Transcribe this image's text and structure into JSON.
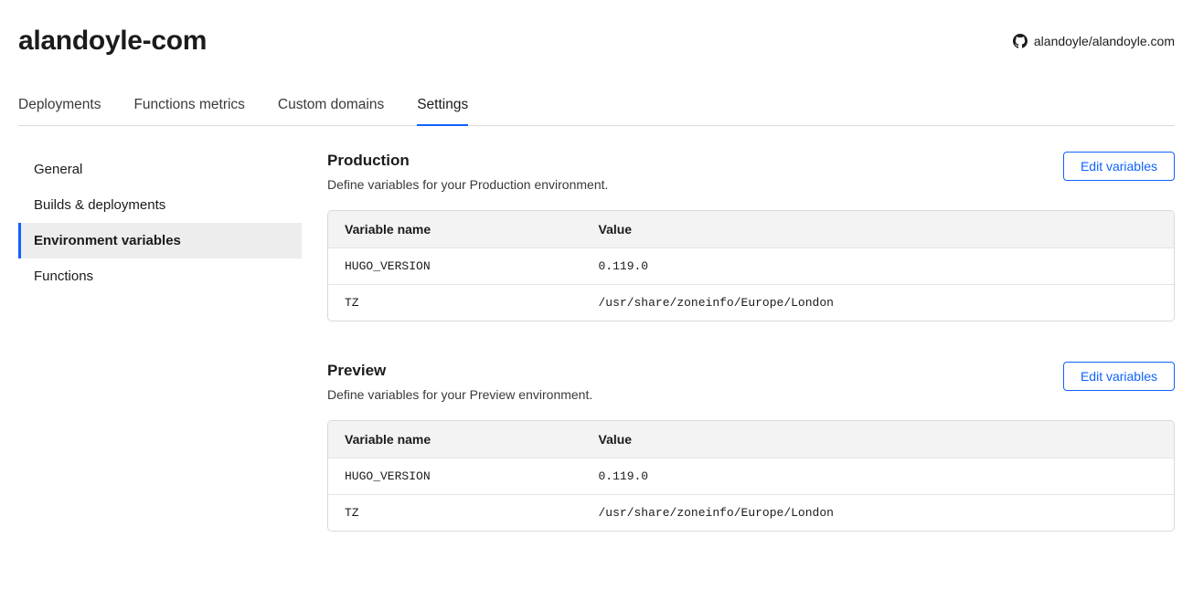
{
  "header": {
    "title": "alandoyle-com",
    "repo": "alandoyle/alandoyle.com"
  },
  "tabs": {
    "deployments": "Deployments",
    "functions_metrics": "Functions metrics",
    "custom_domains": "Custom domains",
    "settings": "Settings"
  },
  "sidebar": {
    "general": "General",
    "builds": "Builds & deployments",
    "envvars": "Environment variables",
    "functions": "Functions"
  },
  "buttons": {
    "edit_variables": "Edit variables"
  },
  "table_headers": {
    "name": "Variable name",
    "value": "Value"
  },
  "sections": {
    "production": {
      "title": "Production",
      "desc": "Define variables for your Production environment.",
      "vars": [
        {
          "name": "HUGO_VERSION",
          "value": "0.119.0"
        },
        {
          "name": "TZ",
          "value": "/usr/share/zoneinfo/Europe/London"
        }
      ]
    },
    "preview": {
      "title": "Preview",
      "desc": "Define variables for your Preview environment.",
      "vars": [
        {
          "name": "HUGO_VERSION",
          "value": "0.119.0"
        },
        {
          "name": "TZ",
          "value": "/usr/share/zoneinfo/Europe/London"
        }
      ]
    }
  }
}
